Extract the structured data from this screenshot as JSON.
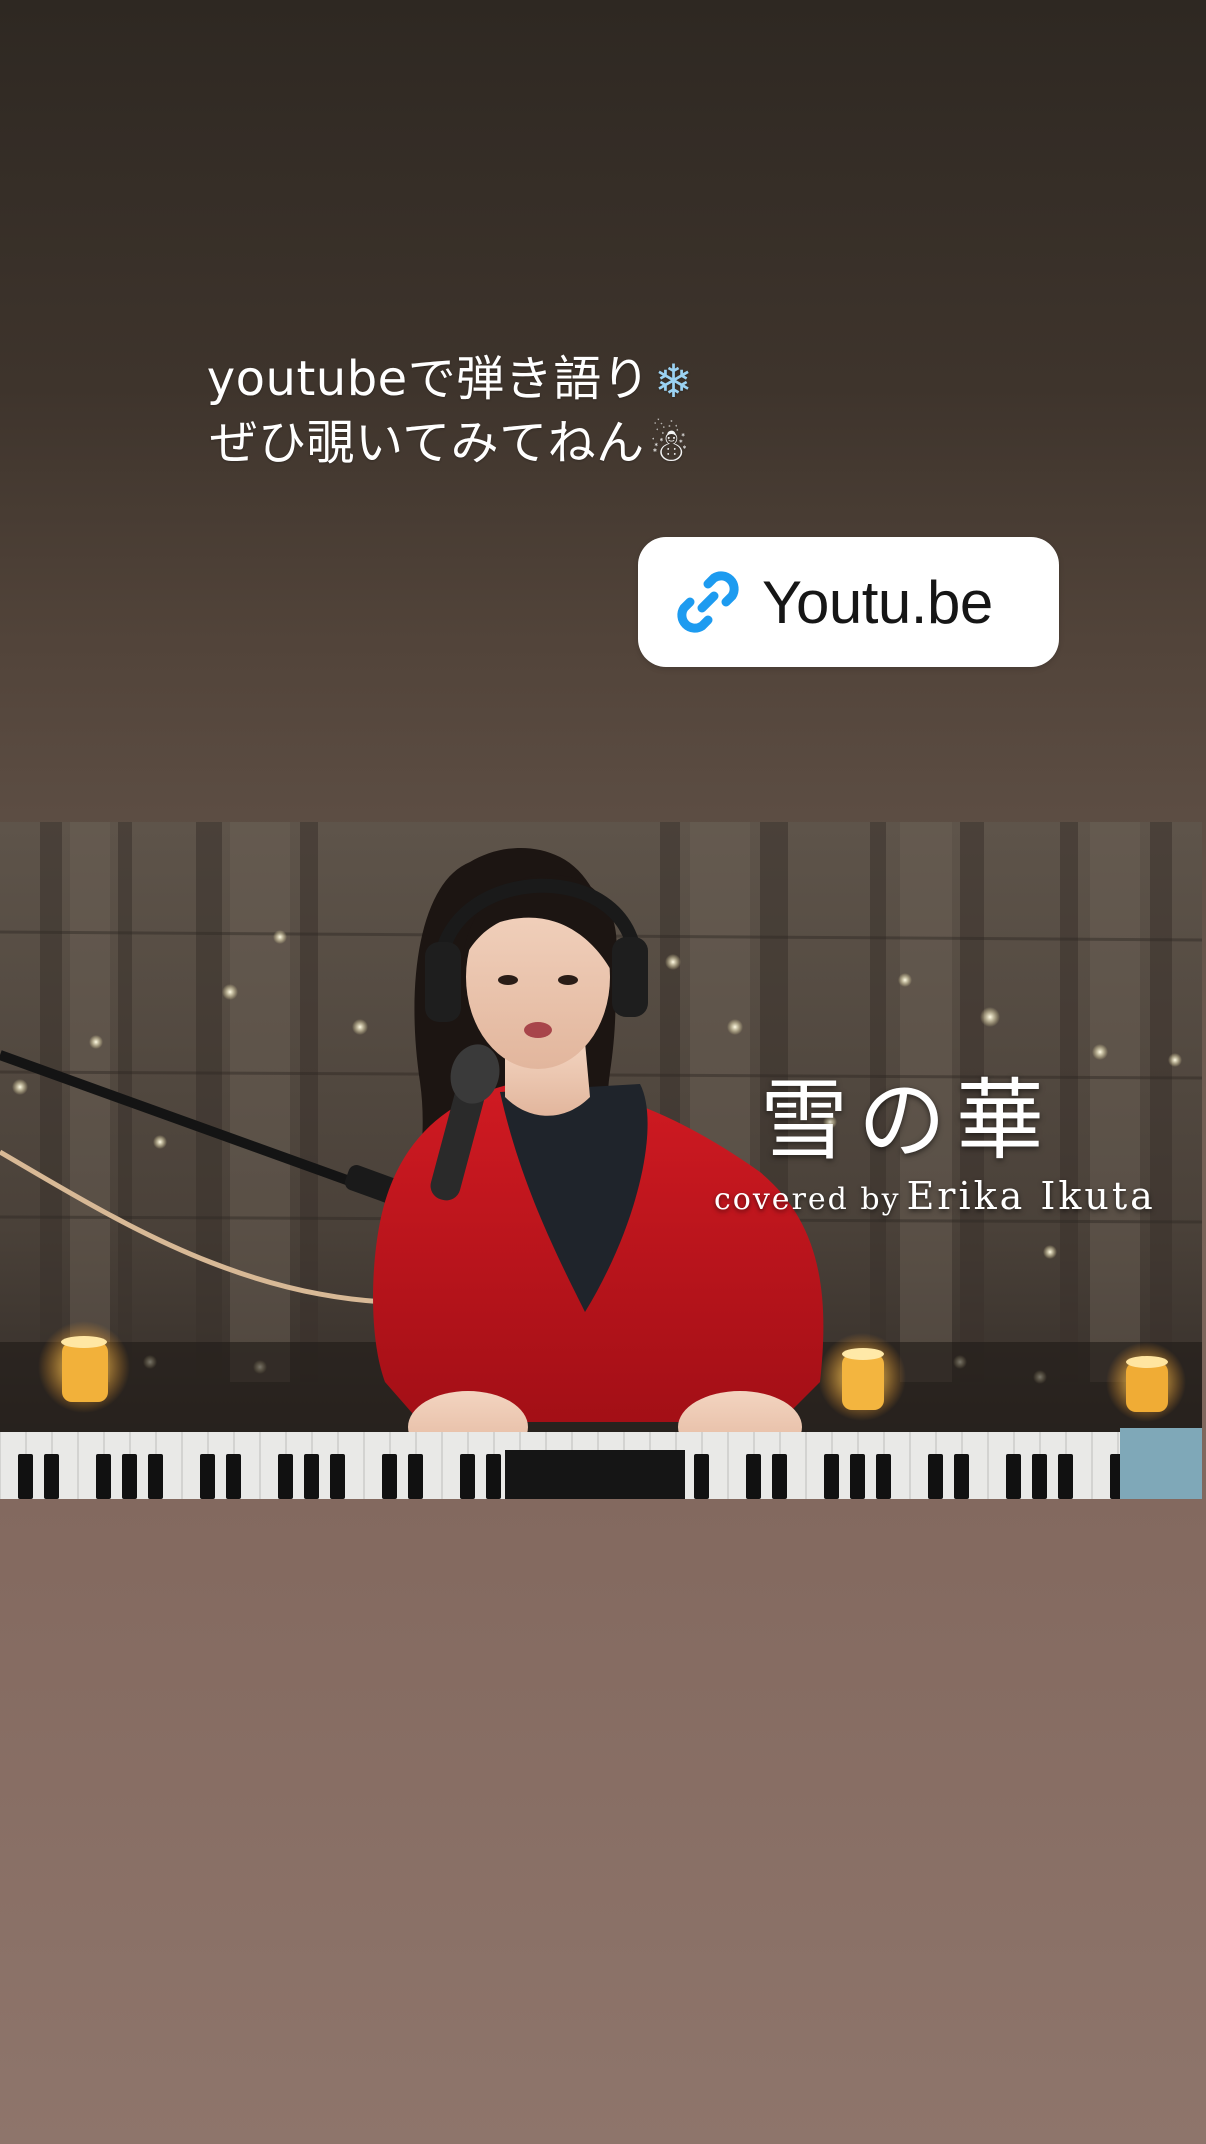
{
  "story": {
    "caption": {
      "line1": "youtubeで弾き語り",
      "line1_emoji": "❄",
      "line2": "ぜひ覗いてみてねん",
      "line2_emoji": "☃"
    },
    "link_sticker": {
      "label": "Youtu.be",
      "icon": "link-icon",
      "icon_color": "#1d9bf0"
    },
    "thumbnail": {
      "title": "雪の華",
      "credit_prefix": "covered by",
      "credit_name": "Erika Ikuta"
    }
  },
  "colors": {
    "background_top": "#2e2822",
    "background_bottom": "#8e756b",
    "sweater": "#c8141c",
    "candle_glow": "#ffcf5a"
  }
}
